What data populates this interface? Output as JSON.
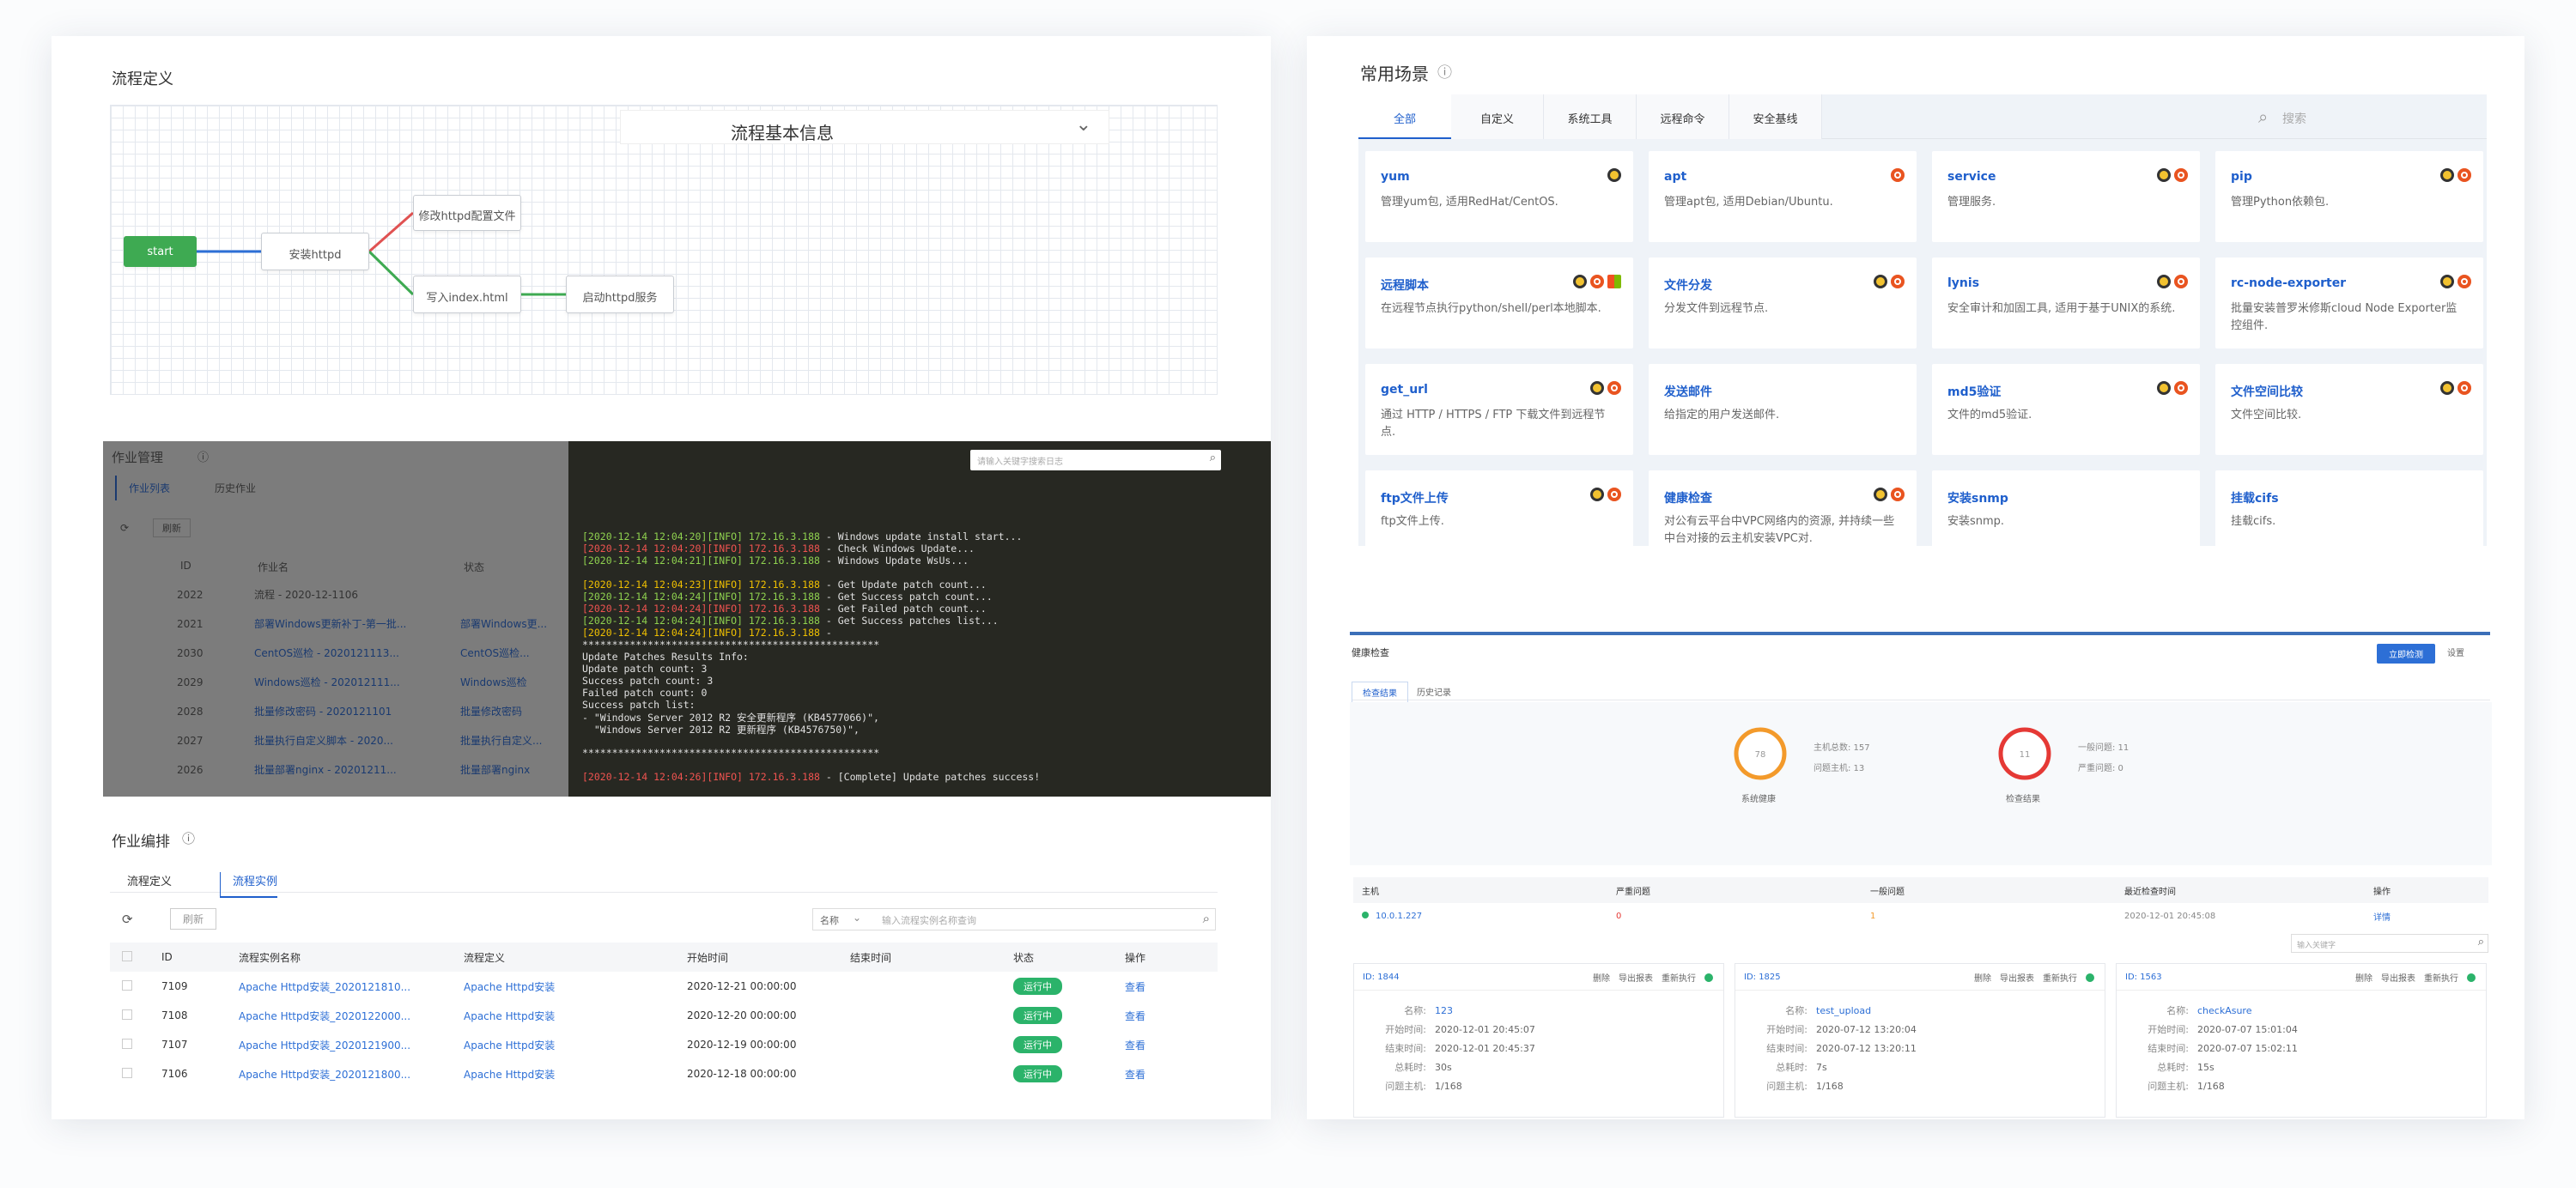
{
  "left": {
    "flow_section_title": "流程定义",
    "flow_bar_title": "流程基本信息",
    "nodes": {
      "start": "start",
      "install": "安装httpd",
      "modify_config": "修改httpd配置文件",
      "write_index": "写入index.html",
      "start_service": "启动httpd服务"
    },
    "job_panel": {
      "title": "作业管理",
      "tabs": [
        "作业列表",
        "历史作业"
      ],
      "refresh_button": "刷新",
      "columns": [
        "ID",
        "作业名",
        "状态"
      ],
      "rows": [
        [
          "2022",
          "流程 - 2020-12-1106"
        ],
        [
          "2021",
          "部署Windows更新补丁-第一批...",
          "部署Windows更..."
        ],
        [
          "2030",
          "CentOS巡检 - 2020121113...",
          "CentOS巡检..."
        ],
        [
          "2029",
          "Windows巡检 - 202012111...",
          "Windows巡检"
        ],
        [
          "2028",
          "批量修改密码 - 2020121101",
          "批量修改密码"
        ],
        [
          "2027",
          "批量执行自定义脚本 - 2020...",
          "批量执行自定义..."
        ],
        [
          "2026",
          "批量部署nginx - 20201211...",
          "批量部署nginx"
        ]
      ]
    },
    "terminal": {
      "search_placeholder": "请输入关键字搜索日志",
      "lines": [
        {
          "text": "[2020-12-14 12:04:20][INFO] 172.16.3.188 - Windows update install start...",
          "color": "#e0e0e0",
          "tag_color": "#8fd14f"
        },
        {
          "text": "[2020-12-14 12:04:20][INFO] 172.16.3.188 - Check Windows Update...",
          "color": "#e0e0e0",
          "tag_color": "#ef5350"
        },
        {
          "text": "[2020-12-14 12:04:21][INFO] 172.16.3.188 - Windows Update WsUs...",
          "color": "#e0e0e0",
          "tag_color": "#8fd14f"
        },
        {
          "text": "",
          "color": "#e0e0e0",
          "tag_color": "#e0e0e0"
        },
        {
          "text": "[2020-12-14 12:04:23][INFO] 172.16.3.188 - Get Update patch count...",
          "color": "#e0e0e0",
          "tag_color": "#f0c000"
        },
        {
          "text": "[2020-12-14 12:04:24][INFO] 172.16.3.188 - Get Success patch count...",
          "color": "#e0e0e0",
          "tag_color": "#8fd14f"
        },
        {
          "text": "[2020-12-14 12:04:24][INFO] 172.16.3.188 - Get Failed patch count...",
          "color": "#e0e0e0",
          "tag_color": "#ef5350"
        },
        {
          "text": "[2020-12-14 12:04:24][INFO] 172.16.3.188 - Get Success patches list...",
          "color": "#e0e0e0",
          "tag_color": "#8fd14f"
        },
        {
          "text": "[2020-12-14 12:04:24][INFO] 172.16.3.188 - ",
          "color": "#e0e0e0",
          "tag_color": "#f0c000"
        },
        {
          "text": "**************************************************",
          "color": "#e0e0e0",
          "tag_color": "#e0e0e0"
        },
        {
          "text": "Update Patches Results Info:",
          "color": "#e0e0e0",
          "tag_color": "#e0e0e0"
        },
        {
          "text": "Update patch count: 3",
          "color": "#e0e0e0",
          "tag_color": "#e0e0e0"
        },
        {
          "text": "Success patch count: 3",
          "color": "#e0e0e0",
          "tag_color": "#e0e0e0"
        },
        {
          "text": "Failed patch count: 0",
          "color": "#e0e0e0",
          "tag_color": "#e0e0e0"
        },
        {
          "text": "Success patch list:",
          "color": "#e0e0e0",
          "tag_color": "#e0e0e0"
        },
        {
          "text": "- \"Windows Server 2012 R2 安全更新程序 (KB4577066)\",",
          "color": "#e0e0e0",
          "tag_color": "#e0e0e0"
        },
        {
          "text": "  \"Windows Server 2012 R2 更新程序 (KB4576750)\",",
          "color": "#e0e0e0",
          "tag_color": "#e0e0e0"
        },
        {
          "text": "",
          "color": "#e0e0e0",
          "tag_color": "#e0e0e0"
        },
        {
          "text": "**************************************************",
          "color": "#e0e0e0",
          "tag_color": "#e0e0e0"
        },
        {
          "text": "",
          "color": "#e0e0e0",
          "tag_color": "#e0e0e0"
        },
        {
          "text": "[2020-12-14 12:04:26][INFO] 172.16.3.188 - [Complete] Update patches success!",
          "color": "#e0e0e0",
          "tag_color": "#ef5350"
        }
      ]
    },
    "job_list": {
      "title": "作业编排",
      "tabs": [
        "流程定义",
        "流程实例"
      ],
      "refresh_button": "刷新",
      "filter_select": "名称",
      "search_placeholder": "输入流程实例名称查询",
      "columns": [
        "ID",
        "流程实例名称",
        "流程定义",
        "开始时间",
        "结束时间",
        "状态",
        "操作"
      ],
      "rows": [
        [
          "7109",
          "Apache Httpd安装_2020121810...",
          "Apache Httpd安装",
          "2020-12-21 00:00:00",
          "",
          "运行中",
          "查看"
        ],
        [
          "7108",
          "Apache Httpd安装_2020122000...",
          "Apache Httpd安装",
          "2020-12-20 00:00:00",
          "",
          "运行中",
          "查看"
        ],
        [
          "7107",
          "Apache Httpd安装_2020121900...",
          "Apache Httpd安装",
          "2020-12-19 00:00:00",
          "",
          "运行中",
          "查看"
        ],
        [
          "7106",
          "Apache Httpd安装_2020121800...",
          "Apache Httpd安装",
          "2020-12-18 00:00:00",
          "",
          "运行中",
          "查看"
        ]
      ]
    }
  },
  "right": {
    "title": "常用场景",
    "tabs": [
      "全部",
      "自定义",
      "系统工具",
      "远程命令",
      "安全基线"
    ],
    "search_placeholder": "搜索",
    "tiles": [
      {
        "name": "yum",
        "desc": "管理yum包, 适用RedHat/CentOS.",
        "icons": [
          "linux"
        ]
      },
      {
        "name": "apt",
        "desc": "管理apt包, 适用Debian/Ubuntu.",
        "icons": [
          "ubuntu"
        ]
      },
      {
        "name": "service",
        "desc": "管理服务.",
        "icons": [
          "linux",
          "ubuntu"
        ]
      },
      {
        "name": "pip",
        "desc": "管理Python依赖包.",
        "icons": [
          "linux",
          "ubuntu"
        ]
      },
      {
        "name": "远程脚本",
        "desc": "在远程节点执行python/shell/perl本地脚本.",
        "icons": [
          "linux",
          "ubuntu",
          "windows"
        ]
      },
      {
        "name": "文件分发",
        "desc": "分发文件到远程节点.",
        "icons": [
          "linux",
          "ubuntu"
        ]
      },
      {
        "name": "lynis",
        "desc": "安全审计和加固工具, 适用于基于UNIX的系统.",
        "icons": [
          "linux",
          "ubuntu"
        ]
      },
      {
        "name": "rc-node-exporter",
        "desc": "批量安装普罗米修斯cloud Node Exporter监控组件.",
        "icons": [
          "linux",
          "ubuntu"
        ]
      },
      {
        "name": "get_url",
        "desc": "通过 HTTP / HTTPS / FTP 下载文件到远程节点.",
        "icons": [
          "linux",
          "ubuntu"
        ]
      },
      {
        "name": "发送邮件",
        "desc": "给指定的用户发送邮件.",
        "icons": []
      },
      {
        "name": "md5验证",
        "desc": "文件的md5验证.",
        "icons": [
          "linux",
          "ubuntu"
        ]
      },
      {
        "name": "文件空间比较",
        "desc": "文件空间比较.",
        "icons": [
          "linux",
          "ubuntu"
        ]
      },
      {
        "name": "ftp文件上传",
        "desc": "ftp文件上传.",
        "icons": [
          "linux",
          "ubuntu"
        ]
      },
      {
        "name": "健康检查",
        "desc": "对公有云平台中VPC网络内的资源, 并持续一些中台对接的云主机安装VPC对.",
        "icons": [
          "linux",
          "ubuntu"
        ]
      },
      {
        "name": "安装snmp",
        "desc": "安装snmp.",
        "icons": []
      },
      {
        "name": "挂载cifs",
        "desc": "挂载cifs.",
        "icons": []
      }
    ],
    "health": {
      "title": "健康检查",
      "button": "立即检测",
      "button2": "设置",
      "tabs": [
        "检查结果",
        "历史记录"
      ],
      "gauge1": {
        "value": "78",
        "label": "系统健康",
        "color": "#f39a2b",
        "stat1": "主机总数: 157",
        "stat2": "问题主机: 13"
      },
      "gauge2": {
        "value": "11",
        "label": "检查结果",
        "color": "#e53935",
        "stat1": "一般问题: 11",
        "stat2": "严重问题: 0"
      },
      "table_columns": [
        "主机",
        "严重问题",
        "一般问题",
        "最近检查时间",
        "操作"
      ],
      "table_row": [
        "10.0.1.227",
        "0",
        "1",
        "2020-12-01 20:45:08",
        "详情"
      ],
      "search_placeholder": "输入关键字",
      "cards": [
        {
          "id": "ID: 1844",
          "actions": [
            "删除",
            "导出报表",
            "重新执行"
          ],
          "rows": [
            [
              "名称:",
              "123"
            ],
            [
              "开始时间:",
              "2020-12-01 20:45:07"
            ],
            [
              "结束时间:",
              "2020-12-01 20:45:37"
            ],
            [
              "总耗时:",
              "30s"
            ],
            [
              "问题主机:",
              "1/168"
            ]
          ]
        },
        {
          "id": "ID: 1825",
          "actions": [
            "删除",
            "导出报表",
            "重新执行"
          ],
          "rows": [
            [
              "名称:",
              "test_upload"
            ],
            [
              "开始时间:",
              "2020-07-12 13:20:04"
            ],
            [
              "结束时间:",
              "2020-07-12 13:20:11"
            ],
            [
              "总耗时:",
              "7s"
            ],
            [
              "问题主机:",
              "1/168"
            ]
          ]
        },
        {
          "id": "ID: 1563",
          "actions": [
            "删除",
            "导出报表",
            "重新执行"
          ],
          "rows": [
            [
              "名称:",
              "checkAsure"
            ],
            [
              "开始时间:",
              "2020-07-07 15:01:04"
            ],
            [
              "结束时间:",
              "2020-07-07 15:02:11"
            ],
            [
              "总耗时:",
              "15s"
            ],
            [
              "问题主机:",
              "1/168"
            ]
          ]
        }
      ]
    }
  }
}
